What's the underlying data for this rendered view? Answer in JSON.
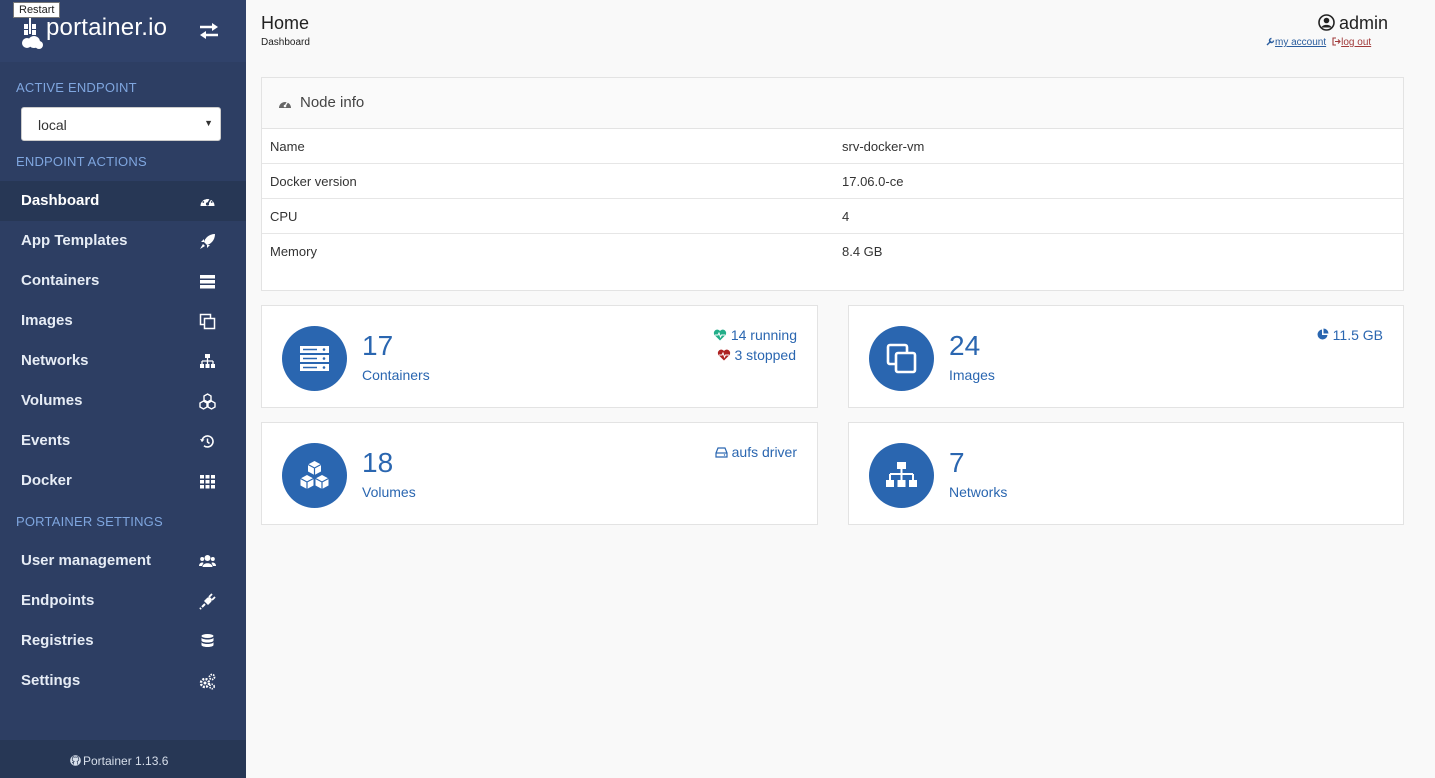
{
  "tooltip": "Restart",
  "brand": {
    "name": "portainer.io"
  },
  "sidebar": {
    "active_endpoint_heading": "ACTIVE ENDPOINT",
    "endpoint_value": "local",
    "endpoint_actions_heading": "ENDPOINT ACTIONS",
    "items": [
      {
        "label": "Dashboard",
        "icon": "dashboard-icon"
      },
      {
        "label": "App Templates",
        "icon": "rocket-icon"
      },
      {
        "label": "Containers",
        "icon": "server-icon"
      },
      {
        "label": "Images",
        "icon": "clone-icon"
      },
      {
        "label": "Networks",
        "icon": "sitemap-icon"
      },
      {
        "label": "Volumes",
        "icon": "cubes-icon"
      },
      {
        "label": "Events",
        "icon": "history-icon"
      },
      {
        "label": "Docker",
        "icon": "th-icon"
      }
    ],
    "settings_heading": "PORTAINER SETTINGS",
    "settings_items": [
      {
        "label": "User management",
        "icon": "users-icon"
      },
      {
        "label": "Endpoints",
        "icon": "plug-icon"
      },
      {
        "label": "Registries",
        "icon": "database-icon"
      },
      {
        "label": "Settings",
        "icon": "cogs-icon"
      }
    ],
    "footer": "Portainer 1.13.6"
  },
  "header": {
    "title": "Home",
    "subtitle": "Dashboard",
    "user": "admin",
    "my_account": "my account",
    "log_out": "log out"
  },
  "node_info": {
    "title": "Node info",
    "rows": [
      {
        "key": "Name",
        "value": "srv-docker-vm"
      },
      {
        "key": "Docker version",
        "value": "17.06.0-ce"
      },
      {
        "key": "CPU",
        "value": "4"
      },
      {
        "key": "Memory",
        "value": "8.4 GB"
      }
    ]
  },
  "widgets": {
    "containers": {
      "count": "17",
      "label": "Containers",
      "running": "14 running",
      "stopped": "3 stopped"
    },
    "images": {
      "count": "24",
      "label": "Images",
      "size": "11.5 GB"
    },
    "volumes": {
      "count": "18",
      "label": "Volumes",
      "driver": "aufs driver"
    },
    "networks": {
      "count": "7",
      "label": "Networks"
    }
  },
  "colors": {
    "sidebar": "#2d3e63",
    "accent": "#2a66b0",
    "running": "#23ae89",
    "stopped": "#ae2323"
  }
}
